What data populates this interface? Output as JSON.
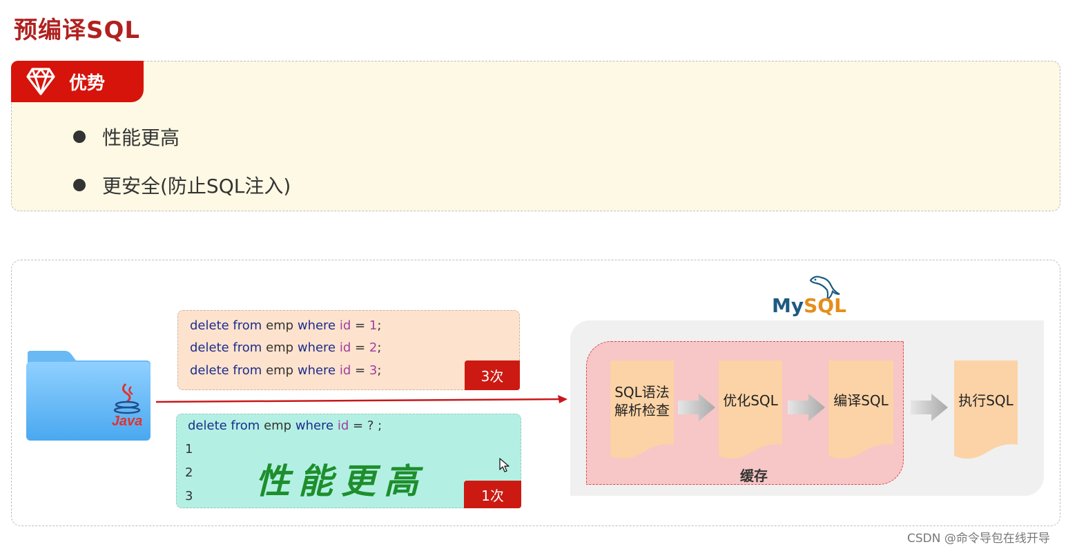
{
  "page_title": "预编译SQL",
  "advantages": {
    "tab_label": "优势",
    "items": [
      "性能更高",
      "更安全(防止SQL注入)"
    ]
  },
  "java_label": "Java",
  "code_top": {
    "lines": [
      {
        "cmd": "delete from",
        "tbl": "emp",
        "kw": "where",
        "col": "id",
        "op": "=",
        "val": "1",
        "end": ";"
      },
      {
        "cmd": "delete from",
        "tbl": "emp",
        "kw": "where",
        "col": "id",
        "op": "=",
        "val": "2",
        "end": ";"
      },
      {
        "cmd": "delete from",
        "tbl": "emp",
        "kw": "where",
        "col": "id",
        "op": "=",
        "val": "3",
        "end": ";"
      }
    ],
    "badge": "3次"
  },
  "code_bottom": {
    "line": {
      "cmd": "delete from",
      "tbl": "emp",
      "kw": "where",
      "col": "id",
      "op": "=",
      "val": "?",
      "end": ";"
    },
    "line_numbers": [
      "1",
      "2",
      "3"
    ],
    "highlight": "性能更高",
    "badge": "1次"
  },
  "mysql": {
    "logo_my": "My",
    "logo_sql": "SQL",
    "cache_label": "缓存",
    "steps": [
      {
        "line1": "SQL语法",
        "line2": "解析检查"
      },
      {
        "line1": "优化SQL",
        "line2": ""
      },
      {
        "line1": "编译SQL",
        "line2": ""
      },
      {
        "line1": "执行SQL",
        "line2": ""
      }
    ]
  },
  "watermark": "CSDN @命令导包在线开导",
  "colors": {
    "title_red": "#b0211f",
    "tab_red": "#d6140b",
    "badge_red": "#cc1a12",
    "highlight_green": "#1e8e2d",
    "mysql_blue": "#1d5a82",
    "mysql_orange": "#e48e1b"
  }
}
